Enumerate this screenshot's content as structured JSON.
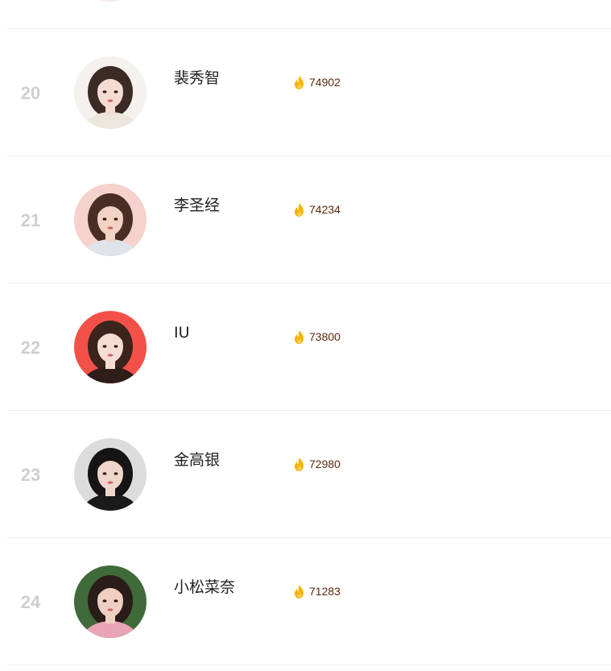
{
  "colors": {
    "rank": "#cfcfcf",
    "name": "#222222",
    "heat_value": "#5a2a0e",
    "flame": "#f5b400",
    "divider": "#f0f0f0"
  },
  "ranking": [
    {
      "rank": "",
      "name": "",
      "heat": "",
      "avatar": {
        "bg": "#f3e3e0",
        "hair": "#2b1c16",
        "skin": "#f3d6c8",
        "cloth": "#f7e8e4"
      }
    },
    {
      "rank": "20",
      "name": "裴秀智",
      "heat": "74902",
      "avatar": {
        "bg": "#f5f2ee",
        "hair": "#3c2a26",
        "skin": "#f4dcd2",
        "cloth": "#ece6df"
      }
    },
    {
      "rank": "21",
      "name": "李圣经",
      "heat": "74234",
      "avatar": {
        "bg": "#f6d2cc",
        "hair": "#4a2e26",
        "skin": "#f1d2c3",
        "cloth": "#dfe4ea"
      }
    },
    {
      "rank": "22",
      "name": "IU",
      "heat": "73800",
      "avatar": {
        "bg": "#f4504a",
        "hair": "#3a241c",
        "skin": "#f6ddd3",
        "cloth": "#2e1d18"
      }
    },
    {
      "rank": "23",
      "name": "金高银",
      "heat": "72980",
      "avatar": {
        "bg": "#dcdcdc",
        "hair": "#161414",
        "skin": "#efd6cc",
        "cloth": "#1b1a1a"
      }
    },
    {
      "rank": "24",
      "name": "小松菜奈",
      "heat": "71283",
      "avatar": {
        "bg": "#3f6a3a",
        "hair": "#2a1c18",
        "skin": "#efcfc2",
        "cloth": "#e8a3b6"
      }
    }
  ]
}
